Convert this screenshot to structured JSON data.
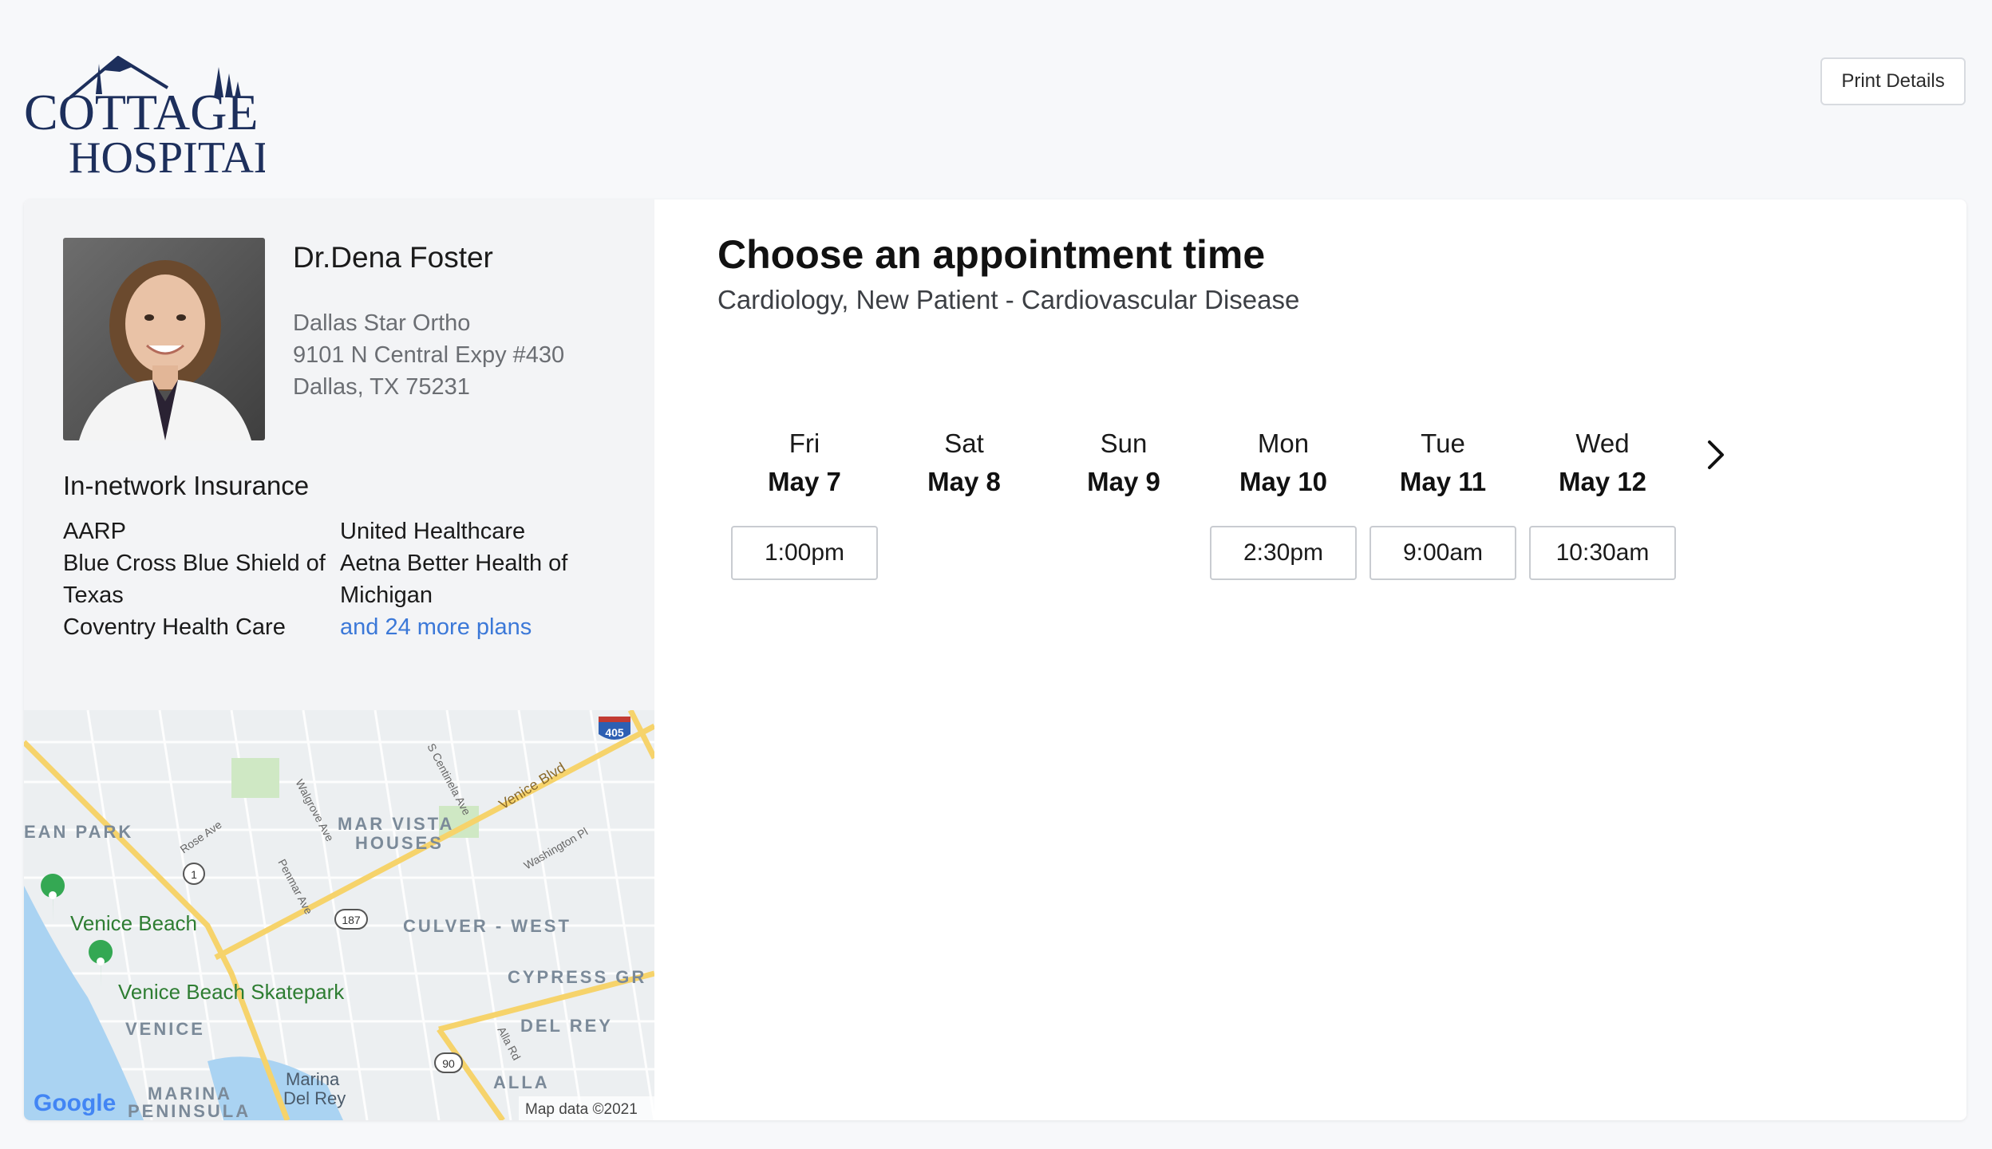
{
  "header": {
    "logo_line1": "COTTAGE",
    "logo_line2": "HOSPITAL",
    "print_label": "Print Details"
  },
  "doctor": {
    "name": "Dr.Dena Foster",
    "practice": "Dallas Star Ortho",
    "street": "9101 N Central Expy #430",
    "city": "Dallas, TX 75231"
  },
  "insurance": {
    "title": "In-network Insurance",
    "col1": [
      "AARP",
      "Blue Cross Blue Shield of Texas",
      "Coventry Health Care"
    ],
    "col2": [
      "United Healthcare",
      "Aetna Better Health of Michigan"
    ],
    "more_link": "and 24 more plans"
  },
  "map": {
    "labels": {
      "ocean_park": "EAN PARK",
      "mar_vista": "MAR VISTA",
      "houses": "HOUSES",
      "culver_west": "CULVER - WEST",
      "cypress": "CYPRESS GR",
      "del_rey": "DEL REY",
      "venice": "VENICE",
      "alla": "ALLA",
      "marina_peninsula1": "MARINA",
      "marina_peninsula2": "PENINSULA",
      "marina_del_rey1": "Marina",
      "marina_del_rey2": "Del Rey",
      "venice_beach": "Venice Beach",
      "skatepark": "Venice Beach Skatepark",
      "venice_blvd": "Venice Blvd",
      "washington_pl": "Washington Pl",
      "rose_ave": "Rose Ave",
      "walgrove_ave": "Walgrove Ave",
      "centinela_ave": "S Centinela Ave",
      "penmar_ave": "Penmar Ave",
      "alla_rd": "Alla Rd",
      "shield_405": "405",
      "shield_1": "1",
      "shield_187": "187",
      "shield_90": "90",
      "google": "Google",
      "map_data": "Map data ©2021"
    }
  },
  "appointment": {
    "title": "Choose an appointment time",
    "subtitle": "Cardiology, New Patient - Cardiovascular Disease",
    "days": [
      {
        "name": "Fri",
        "date": "May 7",
        "slot": "1:00pm"
      },
      {
        "name": "Sat",
        "date": "May 8",
        "slot": ""
      },
      {
        "name": "Sun",
        "date": "May 9",
        "slot": ""
      },
      {
        "name": "Mon",
        "date": "May 10",
        "slot": "2:30pm"
      },
      {
        "name": "Tue",
        "date": "May 11",
        "slot": "9:00am"
      },
      {
        "name": "Wed",
        "date": "May 12",
        "slot": "10:30am"
      }
    ]
  },
  "colors": {
    "link": "#3b78d8",
    "logo": "#1d2f5c",
    "background": "#f7f8fa"
  }
}
